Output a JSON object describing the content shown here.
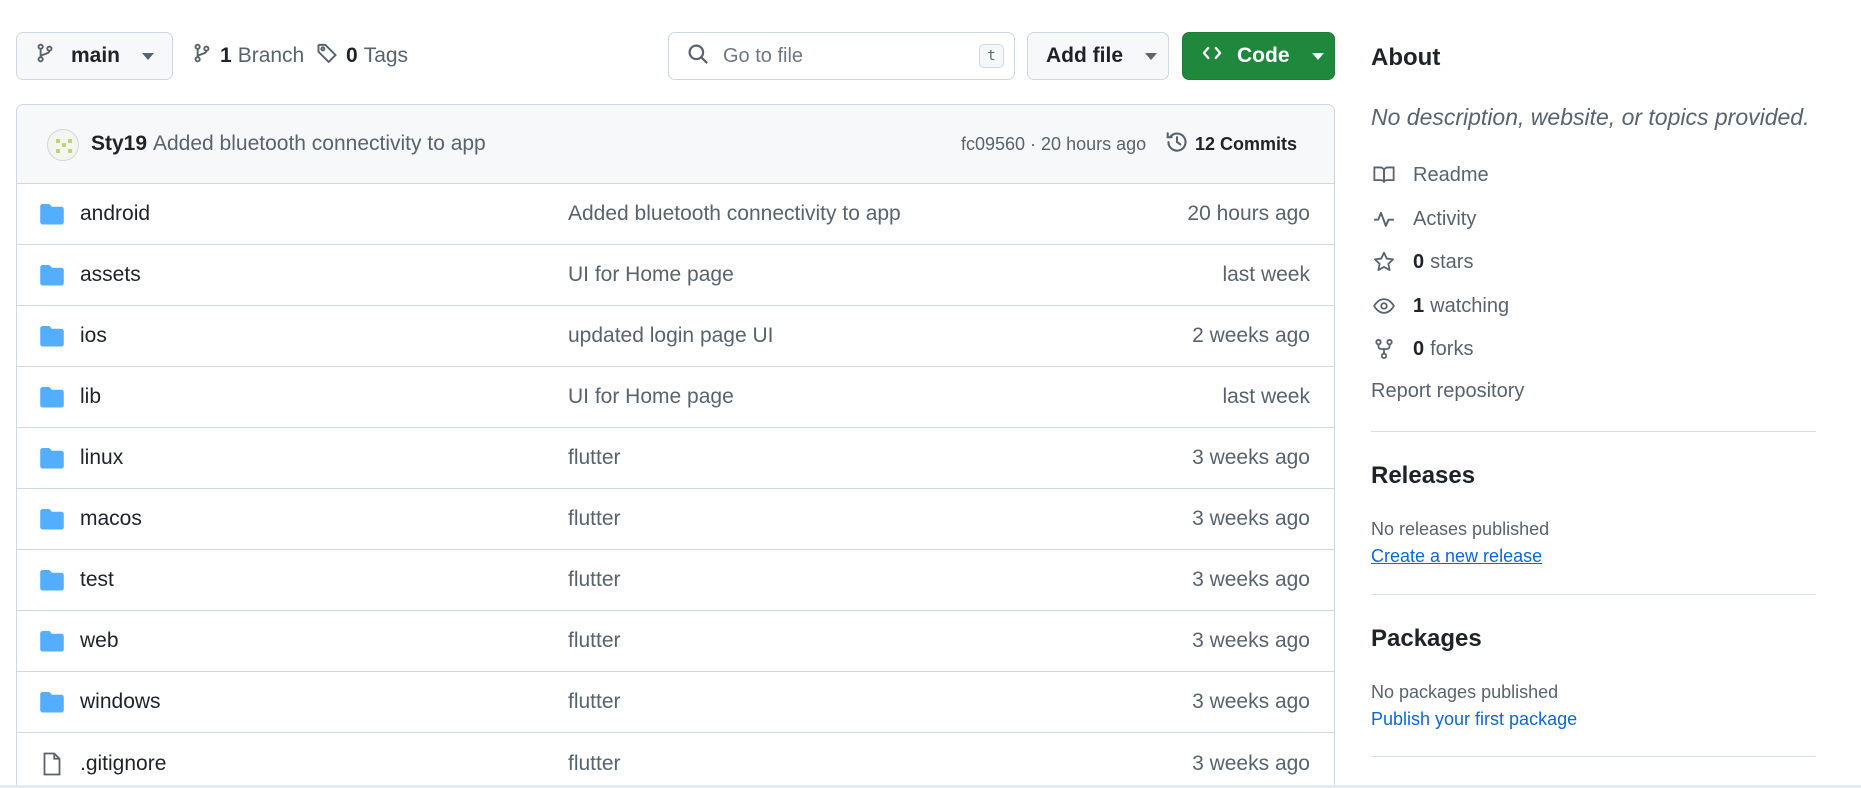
{
  "toolbar": {
    "branch": "main",
    "branches_count": "1",
    "branches_label": "Branch",
    "tags_count": "0",
    "tags_label": "Tags",
    "search_placeholder": "Go to file",
    "search_shortcut": "t",
    "add_file_label": "Add file",
    "code_label": "Code"
  },
  "latest_commit": {
    "author": "Sty19",
    "message": "Added bluetooth connectivity to app",
    "hash_time": "fc09560 · 20 hours ago",
    "commits_label": "12 Commits"
  },
  "files": [
    {
      "name": "android",
      "type": "folder",
      "message": "Added bluetooth connectivity to app",
      "time": "20 hours ago"
    },
    {
      "name": "assets",
      "type": "folder",
      "message": "UI for Home page",
      "time": "last week"
    },
    {
      "name": "ios",
      "type": "folder",
      "message": "updated login page UI",
      "time": "2 weeks ago"
    },
    {
      "name": "lib",
      "type": "folder",
      "message": "UI for Home page",
      "time": "last week"
    },
    {
      "name": "linux",
      "type": "folder",
      "message": "flutter",
      "time": "3 weeks ago"
    },
    {
      "name": "macos",
      "type": "folder",
      "message": "flutter",
      "time": "3 weeks ago"
    },
    {
      "name": "test",
      "type": "folder",
      "message": "flutter",
      "time": "3 weeks ago"
    },
    {
      "name": "web",
      "type": "folder",
      "message": "flutter",
      "time": "3 weeks ago"
    },
    {
      "name": "windows",
      "type": "folder",
      "message": "flutter",
      "time": "3 weeks ago"
    },
    {
      "name": ".gitignore",
      "type": "file",
      "message": "flutter",
      "time": "3 weeks ago"
    }
  ],
  "about": {
    "heading": "About",
    "description": "No description, website, or topics provided.",
    "readme": "Readme",
    "activity": "Activity",
    "stars_count": "0",
    "stars_label": "stars",
    "watching_count": "1",
    "watching_label": "watching",
    "forks_count": "0",
    "forks_label": "forks",
    "report": "Report repository"
  },
  "releases": {
    "heading": "Releases",
    "status": "No releases published",
    "link": "Create a new release"
  },
  "packages": {
    "heading": "Packages",
    "status": "No packages published",
    "link": "Publish your first package"
  },
  "colors": {
    "code_button": "#1f883d",
    "folder_icon": "#54aeff",
    "link": "#0969da"
  }
}
